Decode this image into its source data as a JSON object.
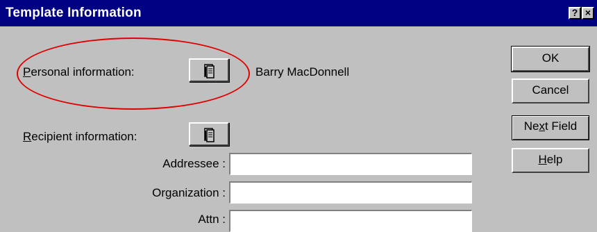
{
  "window": {
    "title": "Template Information"
  },
  "title_buttons": {
    "help": "?",
    "close": "×"
  },
  "personal": {
    "label_accel": "P",
    "label_rest": "ersonal information:",
    "name": "Barry MacDonnell"
  },
  "recipient": {
    "label_accel": "R",
    "label_rest": "ecipient information:"
  },
  "fields": [
    {
      "label": "Addressee :",
      "value": ""
    },
    {
      "label": "Organization :",
      "value": ""
    },
    {
      "label": "Attn :",
      "value": ""
    }
  ],
  "buttons": {
    "ok": "OK",
    "cancel": "Cancel",
    "next_pre": "Ne",
    "next_accel": "x",
    "next_post": "t Field",
    "help_accel": "H",
    "help_rest": "elp"
  },
  "icons": {
    "address_book": "address-book-icon"
  },
  "colors": {
    "titlebar": "#000082",
    "dialog": "#c0c0c0",
    "highlight_oval": "#e00000"
  }
}
